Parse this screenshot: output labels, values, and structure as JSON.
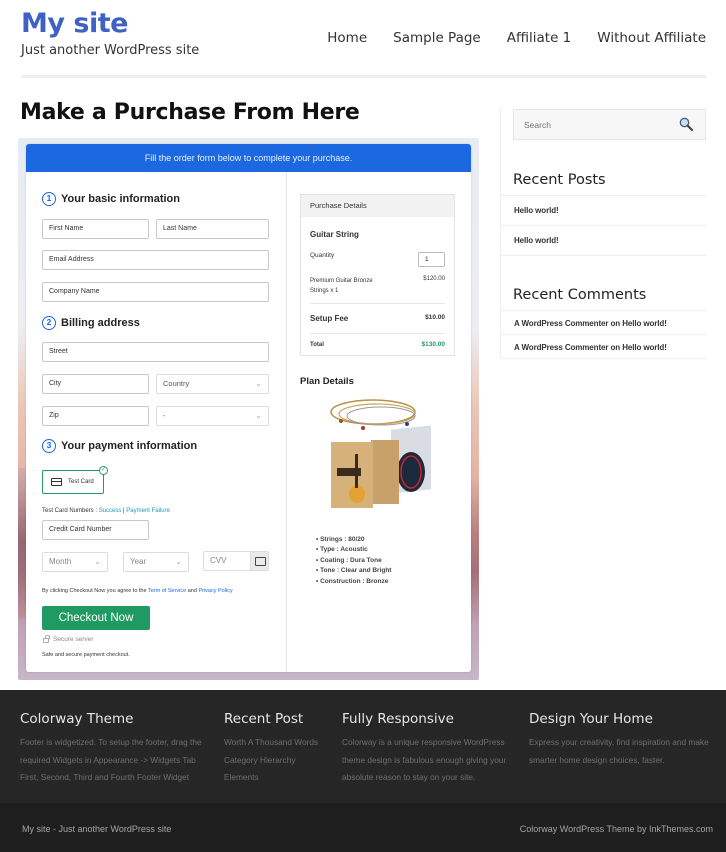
{
  "header": {
    "site_title": "My site",
    "tagline": "Just another WordPress site",
    "nav": [
      "Home",
      "Sample Page",
      "Affiliate 1",
      "Without Affiliate"
    ]
  },
  "page": {
    "title": "Make a Purchase From Here"
  },
  "form": {
    "banner": "Fill the order form below to complete your purchase.",
    "section1": {
      "step": "1",
      "title": "Your basic information"
    },
    "section2": {
      "step": "2",
      "title": "Billing address"
    },
    "section3": {
      "step": "3",
      "title": "Your payment information"
    },
    "fields": {
      "first_name": "First Name",
      "last_name": "Last Name",
      "email": "Email Address",
      "company": "Company Name",
      "street": "Street",
      "city": "City",
      "country": "Country",
      "zip": "Zip",
      "state": "-",
      "card_number": "Credit Card Number",
      "month": "Month",
      "year": "Year",
      "cvv": "CVV"
    },
    "payment_method": "Test Card",
    "test_numbers_label": "Test Card Numbers : ",
    "test_success": "Success",
    "test_sep": " | ",
    "test_failure": "Payment Failure",
    "terms_prefix": "By clicking Checkout Now you agree to the ",
    "terms_link": "Term of Service",
    "terms_and": " and ",
    "privacy_link": "Privacy Policy",
    "checkout_button": "Checkout Now",
    "secure_label": "Secure server",
    "safe_label": "Safe and secure payment checkout."
  },
  "purchase": {
    "header": "Purchase Details",
    "product": "Guitar String",
    "quantity_label": "Quantity",
    "quantity_value": "1",
    "line_item": "Premium Guitar Bronze Strings x 1",
    "line_item_1": "Premium Guitar Bronze",
    "line_item_2": "Strings x 1",
    "line_price": "$120.00",
    "setup_fee_label": "Setup Fee",
    "setup_fee": "$10.00",
    "total_label": "Total",
    "total": "$130.00",
    "total_color": "#1f9a63"
  },
  "plan": {
    "title": "Plan Details",
    "features": [
      "Strings : 80/20",
      "Type : Acoustic",
      "Coating : Dura Tone",
      "Tone : Clear and Bright",
      "Construction : Bronze"
    ]
  },
  "sidebar": {
    "search_placeholder": "Search",
    "recent_posts_title": "Recent Posts",
    "recent_posts": [
      "Hello world!",
      "Hello world!"
    ],
    "recent_comments_title": "Recent Comments",
    "recent_comments": [
      {
        "author": "A WordPress Commenter",
        "on": " on ",
        "post": "Hello world!"
      },
      {
        "author": "A WordPress Commenter",
        "on": " on ",
        "post": "Hello world!"
      }
    ]
  },
  "footer": {
    "col1": {
      "title": "Colorway Theme",
      "lines": [
        "Footer is widgetized. To setup the footer, drag the",
        "required Widgets in Appearance -> Widgets Tab",
        "First, Second, Third and Fourth Footer Widget"
      ]
    },
    "col2": {
      "title": "Recent Post",
      "links": [
        "Worth A Thousand Words",
        "Category Hierarchy",
        "Elements"
      ]
    },
    "col3": {
      "title": "Fully Responsive",
      "lines": [
        "Colorway is a unique responsive WordPress",
        "theme design is fabulous enough giving your",
        "absolute reason to stay on your site."
      ]
    },
    "col4": {
      "title": "Design Your Home",
      "lines": [
        "Express your creativity, find inspiration and make",
        "smarter home design choices, faster."
      ]
    },
    "bottom_left": "My site - Just another WordPress site",
    "bottom_right": "Colorway WordPress Theme by InkThemes.com"
  },
  "colors": {
    "brand": "#3e62c4",
    "banner": "#1b68e1",
    "checkout": "#1f9a63",
    "footer_bg": "#262626"
  }
}
